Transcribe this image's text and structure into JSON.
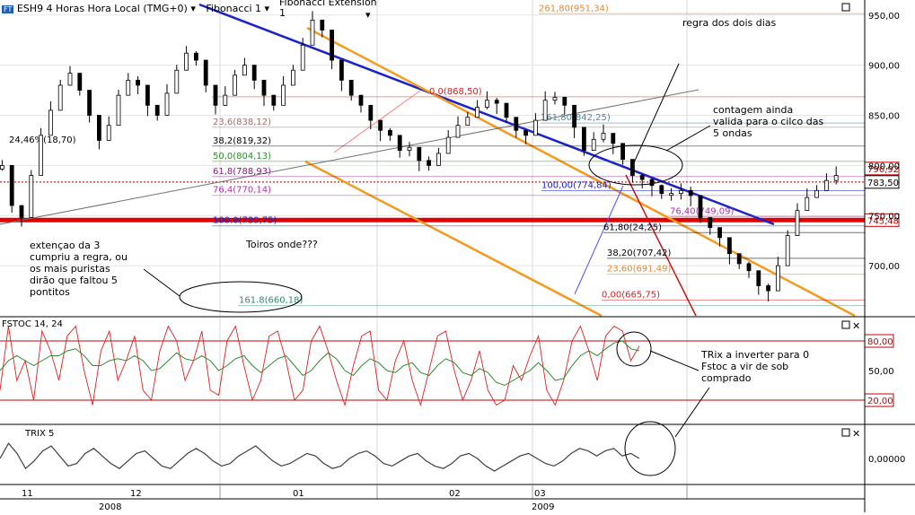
{
  "header": {
    "symbol_badge": "FT",
    "title": "ESH9 4 Horas Hora Local (TMG+0)",
    "fib_label": "Fibonacci 1",
    "fib_ext_label": "Fibonacci Extension",
    "fib_ext_value": "1"
  },
  "chart_data": [
    {
      "type": "line",
      "panel": "price",
      "note_series": "candlestick 4h",
      "ylim": [
        650,
        965
      ],
      "y_ticks": [
        700,
        750,
        800,
        850,
        900,
        950
      ],
      "y_tick_labels": [
        "700,00",
        "750,00",
        "800,00",
        "850,00",
        "900,00",
        "950,00"
      ],
      "grid": true,
      "price_tags": [
        {
          "label": "796,92",
          "value": 796.92,
          "color": "#c00000"
        },
        {
          "label": "783,50",
          "value": 783.5,
          "color": "#000000"
        },
        {
          "label": "745,48",
          "value": 745.48,
          "color": "#c00000"
        }
      ],
      "series": [
        {
          "x": [
            0.0,
            0.9,
            1.8,
            2.7,
            3.6,
            4.5,
            5.4,
            6.3,
            7.2,
            8.1,
            9.0,
            9.9,
            10.8,
            11.7,
            12.6,
            13.5,
            14.4,
            15.3,
            16.2,
            17.1,
            18.0,
            18.9,
            19.8,
            20.7,
            21.6,
            22.5,
            23.4,
            24.3,
            25.2,
            26.1,
            27.0,
            27.9,
            28.8,
            29.7,
            30.6,
            31.5,
            32.4,
            33.3,
            34.2,
            35.1,
            36.0,
            36.9,
            37.8,
            38.7,
            39.6,
            40.5,
            41.4,
            42.3,
            43.2,
            44.1,
            45.0,
            45.9,
            46.8,
            47.7,
            48.6,
            49.5,
            50.4,
            51.3,
            52.2,
            53.1,
            54.0,
            54.9,
            55.8,
            56.7,
            57.6,
            58.5,
            59.4,
            60.3,
            61.2,
            62.1,
            63.0,
            63.9,
            64.8,
            65.7,
            66.6,
            67.5,
            68.4,
            69.3,
            70.2,
            71.1,
            72.0,
            72.9,
            73.8,
            74.7,
            75.6,
            76.5,
            77.4
          ],
          "values": [
            800,
            760,
            748,
            790,
            830,
            855,
            880,
            892,
            875,
            850,
            825,
            840,
            870,
            885,
            880,
            860,
            850,
            872,
            895,
            912,
            905,
            880,
            860,
            870,
            890,
            900,
            885,
            870,
            860,
            880,
            895,
            920,
            945,
            935,
            905,
            885,
            870,
            860,
            845,
            835,
            830,
            815,
            818,
            805,
            800,
            812,
            828,
            840,
            848,
            858,
            865,
            862,
            848,
            835,
            830,
            845,
            865,
            868,
            860,
            838,
            815,
            826,
            832,
            822,
            806,
            790,
            786,
            780,
            772,
            772,
            775,
            770,
            748,
            738,
            728,
            712,
            702,
            695,
            680,
            675,
            700,
            730,
            755,
            768,
            775,
            785,
            790
          ]
        }
      ],
      "fibonacci_levels": [
        {
          "label": "0.0(868,50)",
          "value": 868.5
        },
        {
          "label": "23,6(838,12)",
          "value": 838.12
        },
        {
          "label": "38,2(819,32)",
          "value": 819.32
        },
        {
          "label": "50,0(804,13)",
          "value": 804.13
        },
        {
          "label": "61,8(788,93)",
          "value": 788.93
        },
        {
          "label": "76,4(770,14)",
          "value": 770.14
        },
        {
          "label": "100.0(739,75)",
          "value": 739.75
        },
        {
          "label": "161.8(660,18)",
          "value": 660.18
        }
      ],
      "fibonacci_extension": [
        {
          "label": "261,80(951,34)",
          "value": 951.34
        },
        {
          "label": "161,80(842,25)",
          "value": 842.25
        },
        {
          "label": "100,00(774,84)",
          "value": 774.84
        },
        {
          "label": "76,40(749,09)",
          "value": 749.09
        },
        {
          "label": "61,80(24,25)",
          "value": 733.0
        },
        {
          "label": "38,20(707,42)",
          "value": 707.42
        },
        {
          "label": "23,60(691,49)",
          "value": 691.49
        },
        {
          "label": "0,00(665,75)",
          "value": 665.75
        }
      ],
      "other_labels": {
        "pct_marker": "24,46%(18,70)"
      },
      "annotations": [
        "regra dos dois dias",
        "contagem ainda valida para o cilco das 5 ondas",
        "extençao da 3 cumpriu a regra, ou os mais puristas dirão que faltou 5 pontitos",
        "Toiros onde???"
      ]
    },
    {
      "type": "line",
      "panel": "fstoc",
      "title": "FSTOC 14, 24",
      "ylim": [
        0,
        100
      ],
      "y_ticks": [
        50
      ],
      "y_tick_labels": [
        "50,00"
      ],
      "price_tags": [
        {
          "label": "80,00",
          "value": 80,
          "color": "#c00000"
        },
        {
          "label": "20,00",
          "value": 20,
          "color": "#c00000"
        }
      ],
      "series": [
        {
          "color": "#e02020",
          "values": [
            30,
            95,
            40,
            60,
            20,
            90,
            70,
            40,
            85,
            95,
            50,
            15,
            70,
            90,
            40,
            60,
            85,
            30,
            20,
            70,
            95,
            80,
            40,
            60,
            90,
            30,
            25,
            80,
            95,
            55,
            20,
            40,
            85,
            90,
            60,
            20,
            30,
            80,
            95,
            70,
            40,
            15,
            55,
            85,
            90,
            30,
            20,
            60,
            80,
            40,
            15,
            50,
            85,
            90,
            50,
            20,
            40,
            70,
            30,
            15,
            20,
            55,
            40,
            65,
            85,
            30,
            15,
            40,
            80,
            95,
            70,
            40,
            85,
            95,
            90,
            60,
            75
          ]
        },
        {
          "color": "#2f8a2f",
          "values": [
            50,
            60,
            65,
            60,
            55,
            60,
            65,
            65,
            70,
            72,
            65,
            55,
            55,
            60,
            62,
            60,
            65,
            60,
            50,
            52,
            60,
            68,
            62,
            60,
            65,
            60,
            50,
            55,
            62,
            65,
            55,
            48,
            55,
            62,
            65,
            55,
            45,
            50,
            60,
            68,
            62,
            50,
            45,
            55,
            62,
            58,
            50,
            48,
            55,
            58,
            48,
            45,
            55,
            62,
            58,
            48,
            45,
            52,
            48,
            38,
            35,
            40,
            45,
            50,
            58,
            50,
            40,
            42,
            55,
            65,
            70,
            65,
            72,
            78,
            80,
            72,
            70
          ]
        }
      ],
      "annotations": [
        "TRix a inverter para 0",
        "Fstoc a vir de sob comprado"
      ]
    },
    {
      "type": "line",
      "panel": "trix",
      "title": "TRIX 5",
      "y_ticks": [
        0
      ],
      "y_tick_labels": [
        "0,00000"
      ],
      "series": [
        {
          "color": "#404040",
          "values": [
            0.0,
            0.6,
            0.2,
            -0.4,
            -0.1,
            0.3,
            0.5,
            0.1,
            -0.3,
            -0.2,
            0.2,
            0.4,
            0.1,
            -0.2,
            -0.4,
            -0.1,
            0.2,
            0.3,
            0.0,
            -0.3,
            -0.4,
            -0.1,
            0.2,
            0.4,
            0.2,
            -0.1,
            -0.3,
            -0.2,
            0.1,
            0.3,
            0.5,
            0.2,
            -0.1,
            -0.3,
            -0.2,
            0.0,
            0.2,
            0.1,
            -0.2,
            -0.4,
            -0.3,
            0.0,
            0.2,
            0.3,
            0.1,
            -0.2,
            -0.3,
            -0.1,
            0.1,
            0.2,
            -0.1,
            -0.3,
            -0.4,
            -0.2,
            0.1,
            0.2,
            0.0,
            -0.3,
            -0.5,
            -0.3,
            -0.1,
            0.1,
            0.2,
            0.0,
            -0.2,
            -0.3,
            -0.1,
            0.2,
            0.4,
            0.3,
            0.1,
            0.3,
            0.4,
            0.1,
            0.2,
            0.0
          ]
        }
      ]
    }
  ],
  "time_axis": {
    "month_labels": [
      "11",
      "12",
      "01",
      "02",
      "03"
    ],
    "year_labels": [
      "2008",
      "2009"
    ]
  }
}
